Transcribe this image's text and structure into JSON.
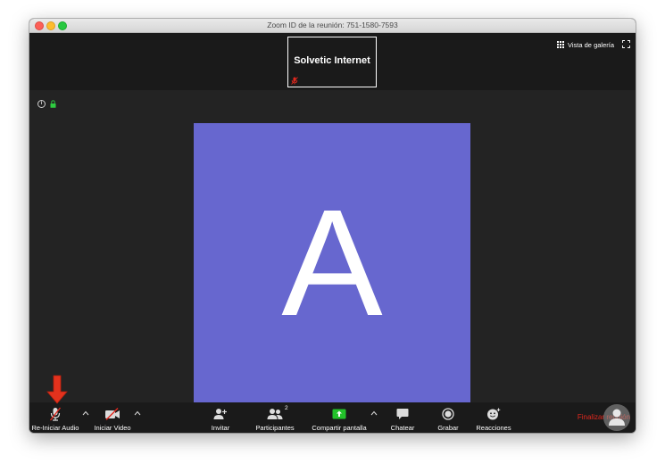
{
  "window": {
    "title": "Zoom ID de la reunión: 751-1580-7593"
  },
  "topbar": {
    "gallery_label": "Vista de galería"
  },
  "thumbnail": {
    "name": "Solvetic Internet"
  },
  "main": {
    "avatar_letter": "A"
  },
  "toolbar": {
    "audio_label": "Re-Iniciar Audio",
    "video_label": "Iniciar Video",
    "invite_label": "Invitar",
    "participants_label": "Participantes",
    "participants_count": "2",
    "share_label": "Compartir pantalla",
    "chat_label": "Chatear",
    "record_label": "Grabar",
    "reactions_label": "Reacciones",
    "end_label": "Finalizar reunión"
  },
  "colors": {
    "avatar_bg": "#6767cf",
    "share_green": "#22c22a",
    "end_red": "#e0281e",
    "annotation_arrow": "#e3321d"
  },
  "icons": {
    "mic": "mic-muted-icon",
    "video": "video-off-icon",
    "invite": "add-person-icon",
    "participants": "people-icon",
    "share": "share-screen-icon",
    "chat": "chat-bubble-icon",
    "record": "record-icon",
    "reactions": "emoji-icon"
  }
}
